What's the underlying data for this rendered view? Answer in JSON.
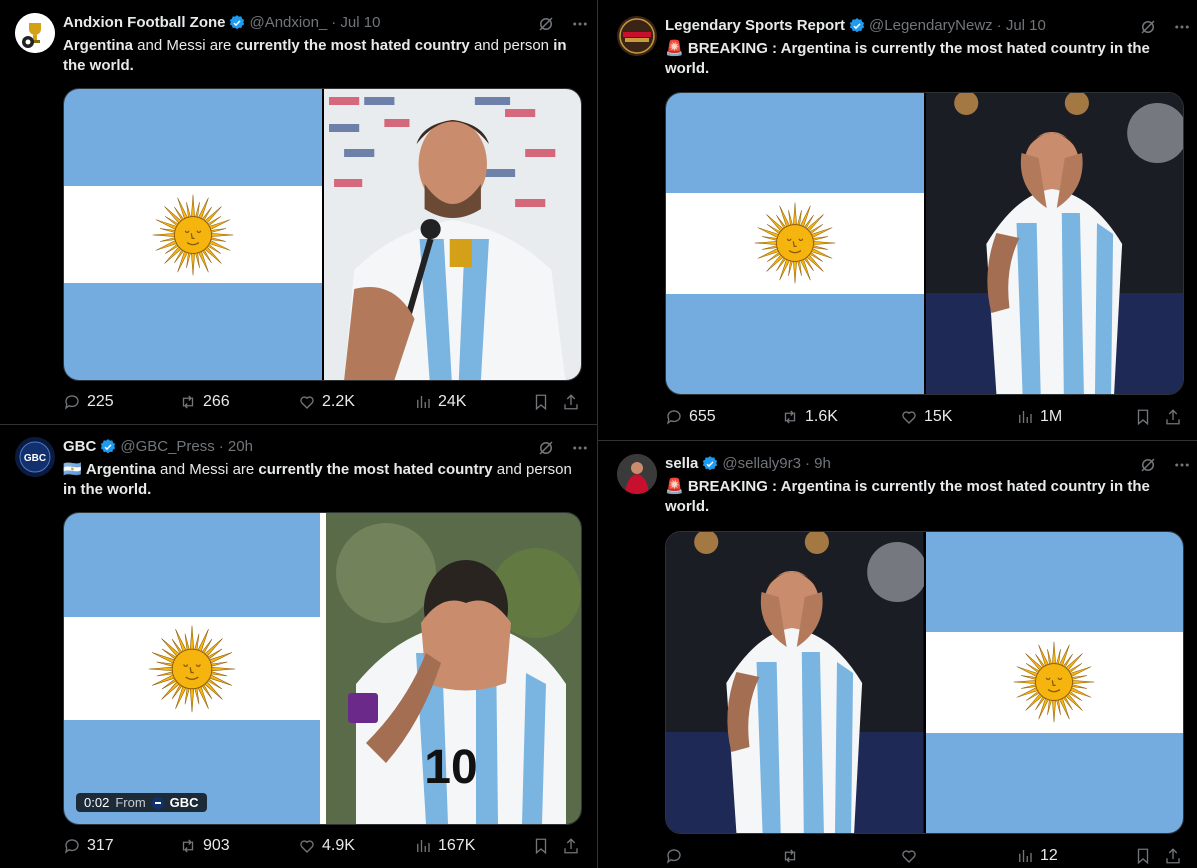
{
  "colors": {
    "accent": "#1d9bf0",
    "muted": "#71767b",
    "flag_blue": "#74acdf",
    "flag_sun": "#f6b40e"
  },
  "tweets": [
    {
      "name": "Andxion Football Zone",
      "handle": "@Andxion_",
      "time": "· Jul 10",
      "text_parts": [
        {
          "t": "Argentina",
          "b": true
        },
        {
          "t": " and Messi are ",
          "b": false
        },
        {
          "t": "currently the most hated country",
          "b": true
        },
        {
          "t": " and person ",
          "b": false
        },
        {
          "t": "in the world.",
          "b": true
        }
      ],
      "stats": {
        "replies": "225",
        "reposts": "266",
        "likes": "2.2K",
        "views": "24K"
      }
    },
    {
      "name": "Legendary Sports Report",
      "handle": "@LegendaryNewz",
      "time": "· Jul 10",
      "text_parts": [
        {
          "t": "🚨 ",
          "b": false
        },
        {
          "t": "BREAKING : Argentina is currently the most hated country in the world.",
          "b": true
        }
      ],
      "stats": {
        "replies": "655",
        "reposts": "1.6K",
        "likes": "15K",
        "views": "1M"
      }
    },
    {
      "name": "GBC",
      "handle": "@GBC_Press",
      "time": "· 20h",
      "text_parts": [
        {
          "t": "🇦🇷 ",
          "b": false
        },
        {
          "t": "Argentina",
          "b": true
        },
        {
          "t": " and Messi are ",
          "b": false
        },
        {
          "t": "currently the most hated country",
          "b": true
        },
        {
          "t": " and person ",
          "b": false
        },
        {
          "t": "in the world.",
          "b": true
        }
      ],
      "stats": {
        "replies": "317",
        "reposts": "903",
        "likes": "4.9K",
        "views": "167K"
      },
      "video": {
        "time": "0:02",
        "from": "From",
        "source": "GBC"
      }
    },
    {
      "name": "sella",
      "handle": "@sellaly9r3",
      "time": "· 9h",
      "text_parts": [
        {
          "t": "🚨 ",
          "b": false
        },
        {
          "t": "BREAKING : Argentina is currently the most hated country in the world.",
          "b": true
        }
      ],
      "stats": {
        "replies": "",
        "reposts": "",
        "likes": "",
        "views": "12"
      }
    }
  ]
}
